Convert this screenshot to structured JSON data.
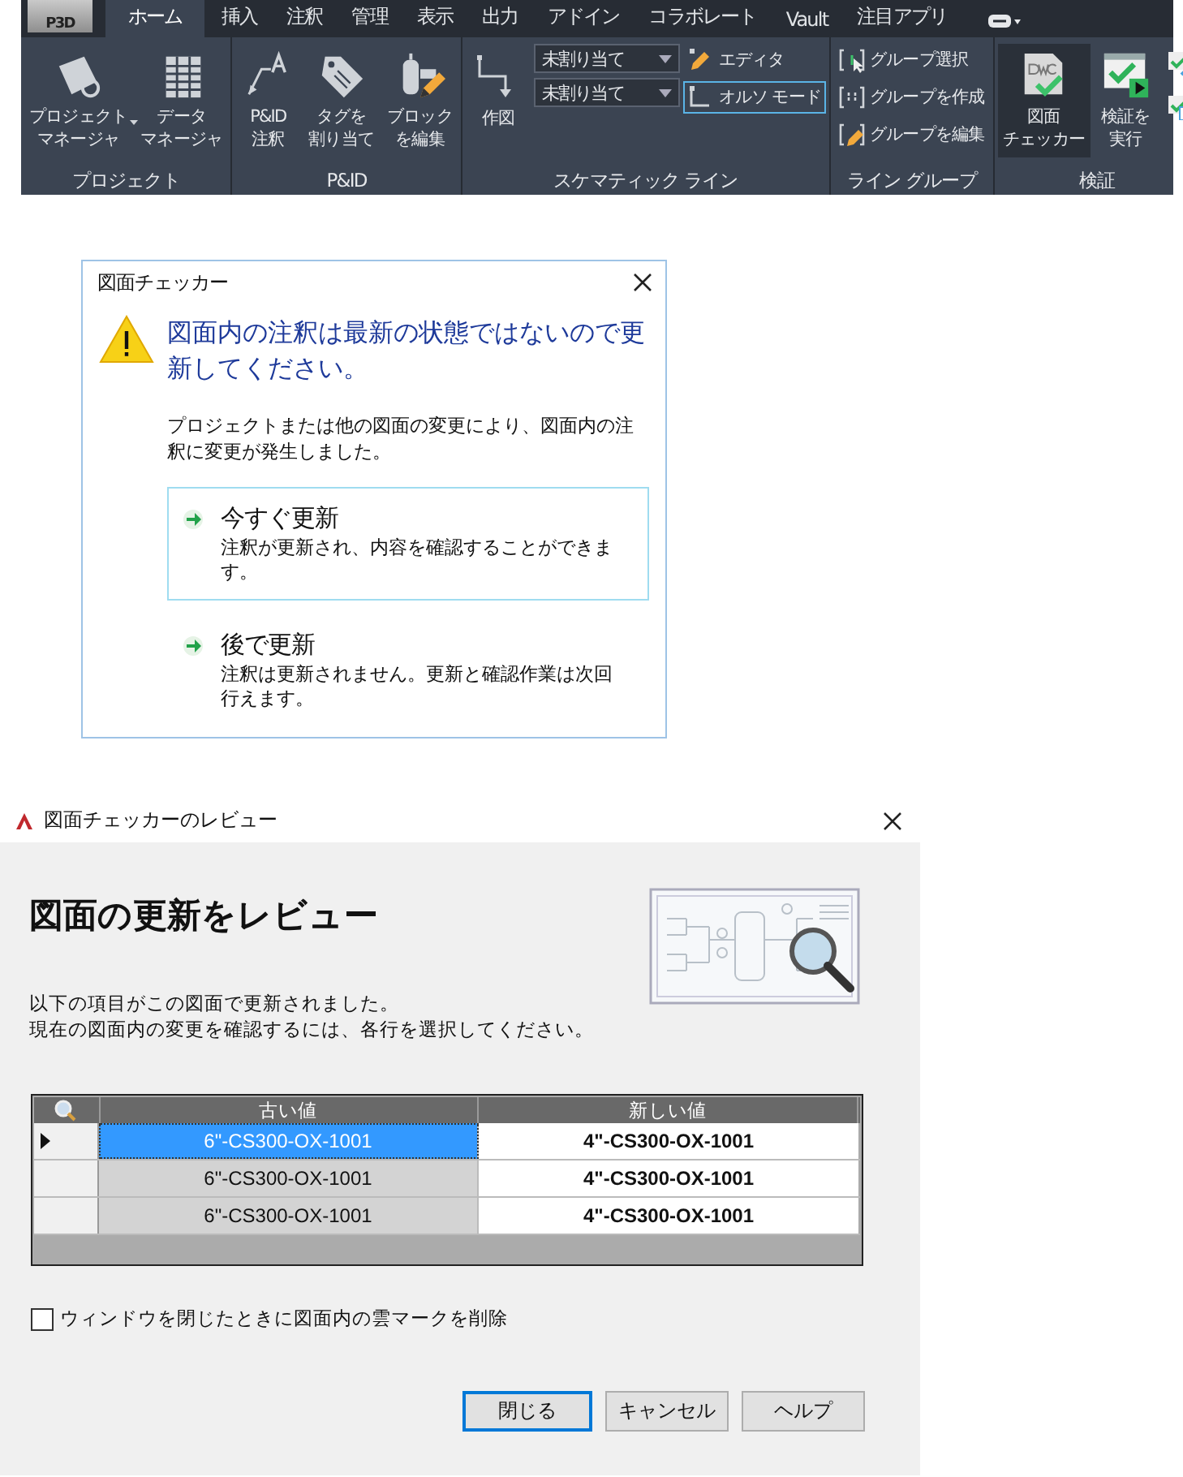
{
  "ribbon": {
    "app_button": "P3D",
    "tabs": [
      {
        "label": "ホーム",
        "selected": true
      },
      {
        "label": "挿入",
        "selected": false
      },
      {
        "label": "注釈",
        "selected": false
      },
      {
        "label": "管理",
        "selected": false
      },
      {
        "label": "表示",
        "selected": false
      },
      {
        "label": "出力",
        "selected": false
      },
      {
        "label": "アドイン",
        "selected": false
      },
      {
        "label": "コラボレート",
        "selected": false
      },
      {
        "label": "Vault",
        "selected": false
      },
      {
        "label": "注目アプリ",
        "selected": false
      }
    ],
    "panels": [
      {
        "title": "プロジェクト",
        "items": [
          {
            "kind": "large",
            "lines": [
              "プロジェクト",
              "マネージャ"
            ],
            "dropdown": true,
            "selected": false
          },
          {
            "kind": "large",
            "lines": [
              "データ",
              "マネージャ"
            ],
            "dropdown": false,
            "selected": false
          }
        ]
      },
      {
        "title": "P&ID",
        "items": [
          {
            "kind": "large",
            "lines": [
              "P&ID",
              "注釈"
            ],
            "dropdown": false,
            "selected": false
          },
          {
            "kind": "large",
            "lines": [
              "タグを",
              "割り当て"
            ],
            "dropdown": false,
            "selected": false
          },
          {
            "kind": "large",
            "lines": [
              "ブロック",
              "を編集"
            ],
            "dropdown": false,
            "selected": false
          }
        ]
      },
      {
        "title": "スケマティック ライン",
        "items": [
          {
            "kind": "large",
            "lines": [
              "作図"
            ],
            "dropdown": false,
            "selected": false
          },
          {
            "kind": "combo",
            "value": "未割り当て"
          },
          {
            "kind": "combo",
            "value": "未割り当て"
          },
          {
            "kind": "small",
            "label": "エディタ",
            "selected": false
          },
          {
            "kind": "small",
            "label": "オルソ モード",
            "selected": true
          }
        ]
      },
      {
        "title": "ライン グループ",
        "items": [
          {
            "kind": "small",
            "label": "グループ選択",
            "selected": false
          },
          {
            "kind": "small",
            "label": "グループを作成",
            "selected": false
          },
          {
            "kind": "small",
            "label": "グループを編集",
            "selected": false
          }
        ]
      },
      {
        "title": "検証",
        "items": [
          {
            "kind": "large",
            "lines": [
              "図面",
              "チェッカー"
            ],
            "dropdown": false,
            "selected": true
          },
          {
            "kind": "large",
            "lines": [
              "検証を",
              "実行"
            ],
            "dropdown": false,
            "selected": false
          },
          {
            "kind": "icon"
          },
          {
            "kind": "icon"
          }
        ]
      }
    ]
  },
  "checker_dialog": {
    "title": "図面チェッカー",
    "heading": "図面内の注釈は最新の状態ではないので更新してください。",
    "message": "プロジェクトまたは他の図面の変更により、図面内の注釈に変更が発生しました。",
    "options": [
      {
        "title": "今すぐ更新",
        "description": "注釈が更新され、内容を確認することができます。",
        "selected": true
      },
      {
        "title": "後で更新",
        "description": "注釈は更新されません。更新と確認作業は次回行えます。",
        "selected": false
      }
    ]
  },
  "review_dialog": {
    "title": "図面チェッカーのレビュー",
    "heading": "図面の更新をレビュー",
    "description": [
      "以下の項目がこの図面で更新されました。",
      "現在の図面内の変更を確認するには、各行を選択してください。"
    ],
    "table": {
      "columns": [
        "古い値",
        "新しい値"
      ],
      "rows": [
        {
          "old": "6\"-CS300-OX-1001",
          "new": "4\"-CS300-OX-1001",
          "selected": true
        },
        {
          "old": "6\"-CS300-OX-1001",
          "new": "4\"-CS300-OX-1001",
          "selected": false
        },
        {
          "old": "6\"-CS300-OX-1001",
          "new": "4\"-CS300-OX-1001",
          "selected": false
        }
      ]
    },
    "checkbox": {
      "label": "ウィンドウを閉じたときに図面内の雲マークを削除",
      "checked": false
    },
    "buttons": [
      {
        "label": "閉じる",
        "default": true
      },
      {
        "label": "キャンセル",
        "default": false
      },
      {
        "label": "ヘルプ",
        "default": false
      }
    ]
  }
}
